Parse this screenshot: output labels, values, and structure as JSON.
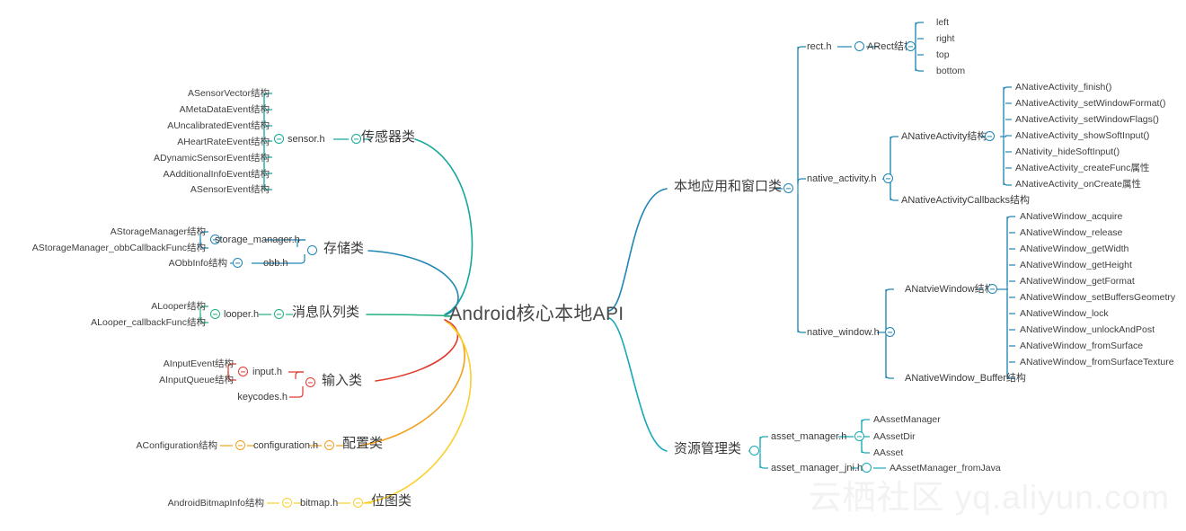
{
  "root": {
    "label": "Android核心本地API"
  },
  "watermark": {
    "text": "云栖社区 yq.aliyun.com"
  },
  "colors": {
    "sensor": "#15a89a",
    "storage": "#1f86b4",
    "queue": "#22b07d",
    "input": "#e03a2f",
    "config": "#f0a01e",
    "bitmap": "#fad02c",
    "app_window": "#1f86b4",
    "resource": "#1aa8b8",
    "text": "#3b3b3b"
  },
  "categories": {
    "sensor": "传感器类",
    "storage": "存储类",
    "queue": "消息队列类",
    "input": "输入类",
    "config": "配置类",
    "bitmap": "位图类",
    "app_window": "本地应用和窗口类",
    "resource": "资源管理类"
  },
  "headers": {
    "sensor_h": "sensor.h",
    "storage_manager_h": "storage_manager.h",
    "obb_h": "obb.h",
    "looper_h": "looper.h",
    "input_h": "input.h",
    "keycodes_h": "keycodes.h",
    "configuration_h": "configuration.h",
    "bitmap_h": "bitmap.h",
    "rect_h": "rect.h",
    "native_activity_h": "native_activity.h",
    "native_window_h": "native_window.h",
    "asset_manager_h": "asset_manager.h",
    "asset_manager_jni_h": "asset_manager_jni.h"
  },
  "structs": {
    "arect": "ARect结构",
    "anative_activity": "ANativeActivity结构",
    "anative_activity_callbacks": "ANativeActivityCallbacks结构",
    "anative_window": "ANatvieWindow结构",
    "anative_window_buffer": "ANativeWindow_Buffer结构"
  },
  "sensor_leaves": [
    "ASensorVector结构",
    "AMetaDataEvent结构",
    "AUncalibratedEvent结构",
    "AHeartRateEvent结构",
    "ADynamicSensorEvent结构",
    "AAdditionalInfoEvent结构",
    "ASensorEvent结构"
  ],
  "storage_leaves": [
    "AStorageManager结构",
    "AStorageManager_obbCallbackFunc结构"
  ],
  "obb_leaves": [
    "AObbInfo结构"
  ],
  "looper_leaves": [
    "ALooper结构",
    "ALooper_callbackFunc结构"
  ],
  "input_leaves": [
    "AInputEvent结构",
    "AInputQueue结构"
  ],
  "config_leaves": [
    "AConfiguration结构"
  ],
  "bitmap_leaves": [
    "AndroidBitmapInfo结构"
  ],
  "arect_leaves": [
    "left",
    "right",
    "top",
    "bottom"
  ],
  "native_activity_leaves": [
    "ANativeActivity_finish()",
    "ANativeActivity_setWindowFormat()",
    "ANativeActivity_setWindowFlags()",
    "ANativeActivity_showSoftInput()",
    "ANativity_hideSoftInput()",
    "ANativeActivity_createFunc属性",
    "ANativeActivity_onCreate属性"
  ],
  "native_window_leaves": [
    "ANativeWindow_acquire",
    "ANativeWindow_release",
    "ANativeWindow_getWidth",
    "ANativeWindow_getHeight",
    "ANativeWindow_getFormat",
    "ANativeWindow_setBuffersGeometry",
    "ANativeWindow_lock",
    "ANativeWindow_unlockAndPost",
    "ANativeWindow_fromSurface",
    "ANativeWindow_fromSurfaceTexture"
  ],
  "asset_manager_leaves": [
    "AAssetManager",
    "AAssetDir",
    "AAsset"
  ],
  "asset_manager_jni_leaves": [
    "AAssetManager_fromJava"
  ]
}
